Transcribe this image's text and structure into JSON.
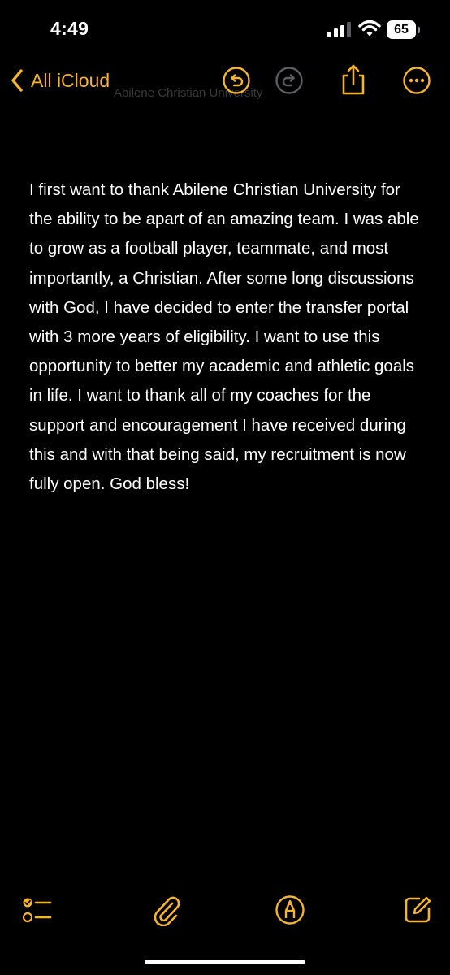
{
  "status_bar": {
    "time": "4:49",
    "battery_level": "65"
  },
  "nav": {
    "back_label": "All iCloud",
    "ghost_title": "Abilene Christian University"
  },
  "note": {
    "body": "I first want to thank Abilene Christian University for the ability to be apart of an amazing team. I was able to grow as a football player, teammate, and most importantly, a Christian. After some long discussions with God, I have decided to enter the transfer portal with 3 more years of eligibility. I want to use this opportunity to better my academic and athletic goals in life. I want to thank all of my coaches for the support and encouragement I have received during this and with that being said, my recruitment is now fully open. God bless!"
  },
  "colors": {
    "accent": "#f7b52c",
    "background": "#000000",
    "text": "#ffffff"
  },
  "icons": {
    "back": "chevron-left-icon",
    "undo": "undo-icon",
    "redo": "redo-icon",
    "share": "share-icon",
    "more": "ellipsis-circle-icon",
    "checklist": "checklist-icon",
    "attach": "paperclip-icon",
    "markup": "markup-pen-icon",
    "compose": "compose-icon"
  }
}
